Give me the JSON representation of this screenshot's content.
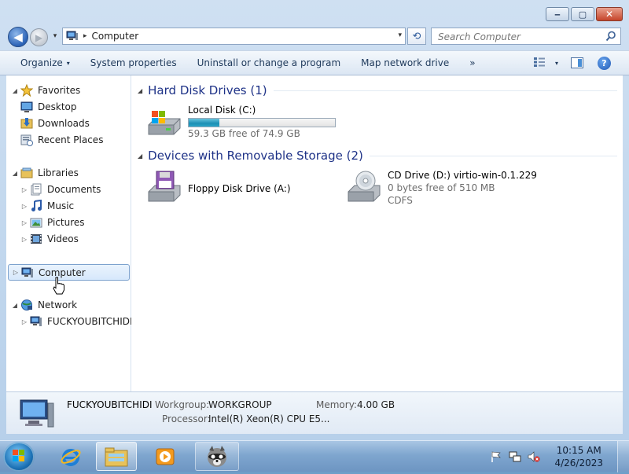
{
  "window": {
    "title": "Computer"
  },
  "caption": {
    "minimize": "‒",
    "maximize": "▢",
    "close": "✕"
  },
  "nav": {
    "back": "◀",
    "forward": "▶",
    "recent": "▾"
  },
  "address": {
    "separator": "▸",
    "path": "Computer",
    "dropdown": "▾"
  },
  "refresh_glyph": "⟲",
  "search": {
    "placeholder": "Search Computer"
  },
  "toolbar": {
    "organize": "Organize",
    "organize_arrow": "▾",
    "system_properties": "System properties",
    "uninstall": "Uninstall or change a program",
    "map_drive": "Map network drive",
    "more": "»",
    "views_arrow": "▾",
    "help": "?"
  },
  "sidebar": {
    "favorites": {
      "label": "Favorites",
      "expander": "◢",
      "items": [
        "Desktop",
        "Downloads",
        "Recent Places"
      ]
    },
    "libraries": {
      "label": "Libraries",
      "expander": "◢",
      "items": [
        "Documents",
        "Music",
        "Pictures",
        "Videos"
      ],
      "child_expander": "▷"
    },
    "computer": {
      "label": "Computer",
      "expander": "▷"
    },
    "network": {
      "label": "Network",
      "expander": "◢",
      "items": [
        "FUCKYOUBITCHIDI"
      ],
      "child_expander": "▷"
    }
  },
  "content": {
    "groups": [
      {
        "title": "Hard Disk Drives (1)",
        "toggle": "◢",
        "items": [
          {
            "name": "Local Disk (C:)",
            "free_text": "59.3 GB free of 74.9 GB",
            "used_fraction": 0.21
          }
        ]
      },
      {
        "title": "Devices with Removable Storage (2)",
        "toggle": "◢",
        "items": [
          {
            "name": "Floppy Disk Drive (A:)"
          },
          {
            "name": "CD Drive (D:) virtio-win-0.1.229",
            "free_text": "0 bytes free of 510 MB",
            "fs": "CDFS"
          }
        ]
      }
    ]
  },
  "details": {
    "computer_name": "FUCKYOUBITCHIDI",
    "workgroup_label": "Workgroup:",
    "workgroup_value": "WORKGROUP",
    "memory_label": "Memory:",
    "memory_value": "4.00 GB",
    "processor_label": "Processor:",
    "processor_value": "Intel(R) Xeon(R) CPU E5..."
  },
  "taskbar": {
    "time": "10:15 AM",
    "date": "4/26/2023",
    "apps": [
      "internet-explorer",
      "windows-explorer",
      "windows-media-player",
      "raccoon-app"
    ]
  },
  "colors": {
    "group_title": "#1e3287",
    "selection_border": "#7da2ce",
    "capacity_fill": "#1c8fb4"
  }
}
